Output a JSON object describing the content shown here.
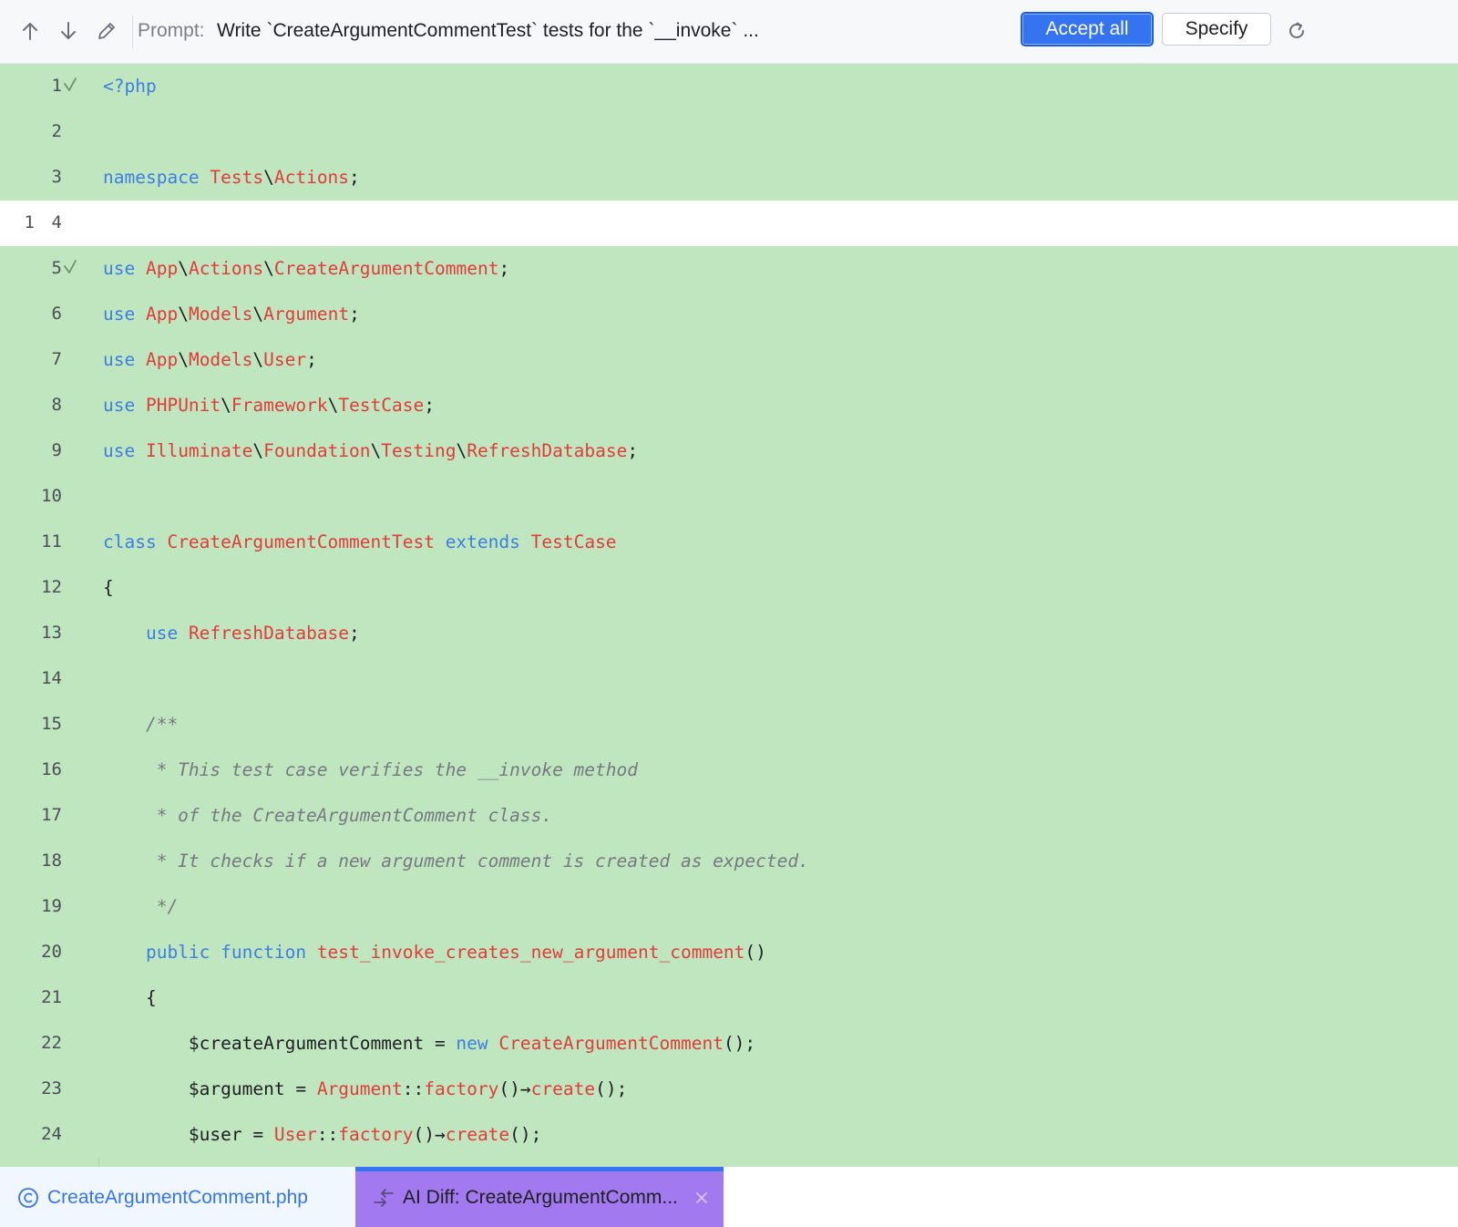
{
  "toolbar": {
    "prompt_label": "Prompt:",
    "prompt_text": "Write `CreateArgumentCommentTest` tests for the `__invoke` ...",
    "accept_all_label": "Accept all",
    "specify_label": "Specify",
    "icons": [
      "arrow-up-icon",
      "arrow-down-icon",
      "pencil-icon",
      "refresh-icon"
    ]
  },
  "colors": {
    "added_bg": "#bfe6bf",
    "keyword": "#3d7fe0",
    "identifier": "#e23b3b",
    "comment": "#767a80",
    "accent": "#3574f0",
    "active_tab": "#a379ef"
  },
  "editor": {
    "lines": [
      {
        "old": "",
        "new": "1",
        "check": true,
        "status": "added",
        "tokens": [
          [
            "kw",
            "<?php"
          ]
        ]
      },
      {
        "old": "",
        "new": "2",
        "check": false,
        "status": "added",
        "tokens": []
      },
      {
        "old": "",
        "new": "3",
        "check": false,
        "status": "added",
        "tokens": [
          [
            "kw",
            "namespace "
          ],
          [
            "id",
            "Tests"
          ],
          [
            "pl",
            "\\"
          ],
          [
            "id",
            "Actions"
          ],
          [
            "pl",
            ";"
          ]
        ]
      },
      {
        "old": "1",
        "new": "4",
        "check": false,
        "status": "unchanged",
        "tokens": []
      },
      {
        "old": "",
        "new": "5",
        "check": true,
        "status": "added",
        "tokens": [
          [
            "kw",
            "use "
          ],
          [
            "id",
            "App"
          ],
          [
            "pl",
            "\\"
          ],
          [
            "id",
            "Actions"
          ],
          [
            "pl",
            "\\"
          ],
          [
            "id",
            "CreateArgumentComment"
          ],
          [
            "pl",
            ";"
          ]
        ]
      },
      {
        "old": "",
        "new": "6",
        "check": false,
        "status": "added",
        "tokens": [
          [
            "kw",
            "use "
          ],
          [
            "id",
            "App"
          ],
          [
            "pl",
            "\\"
          ],
          [
            "id",
            "Models"
          ],
          [
            "pl",
            "\\"
          ],
          [
            "id",
            "Argument"
          ],
          [
            "pl",
            ";"
          ]
        ]
      },
      {
        "old": "",
        "new": "7",
        "check": false,
        "status": "added",
        "tokens": [
          [
            "kw",
            "use "
          ],
          [
            "id",
            "App"
          ],
          [
            "pl",
            "\\"
          ],
          [
            "id",
            "Models"
          ],
          [
            "pl",
            "\\"
          ],
          [
            "id",
            "User"
          ],
          [
            "pl",
            ";"
          ]
        ]
      },
      {
        "old": "",
        "new": "8",
        "check": false,
        "status": "added",
        "tokens": [
          [
            "kw",
            "use "
          ],
          [
            "id",
            "PHPUnit"
          ],
          [
            "pl",
            "\\"
          ],
          [
            "id",
            "Framework"
          ],
          [
            "pl",
            "\\"
          ],
          [
            "id",
            "TestCase"
          ],
          [
            "pl",
            ";"
          ]
        ]
      },
      {
        "old": "",
        "new": "9",
        "check": false,
        "status": "added",
        "tokens": [
          [
            "kw",
            "use "
          ],
          [
            "id",
            "Illuminate"
          ],
          [
            "pl",
            "\\"
          ],
          [
            "id",
            "Foundation"
          ],
          [
            "pl",
            "\\"
          ],
          [
            "id",
            "Testing"
          ],
          [
            "pl",
            "\\"
          ],
          [
            "id",
            "RefreshDatabase"
          ],
          [
            "pl",
            ";"
          ]
        ]
      },
      {
        "old": "",
        "new": "10",
        "check": false,
        "status": "added",
        "tokens": []
      },
      {
        "old": "",
        "new": "11",
        "check": false,
        "status": "added",
        "tokens": [
          [
            "kw",
            "class "
          ],
          [
            "id",
            "CreateArgumentCommentTest"
          ],
          [
            "kw",
            " extends "
          ],
          [
            "id",
            "TestCase"
          ]
        ]
      },
      {
        "old": "",
        "new": "12",
        "check": false,
        "status": "added",
        "tokens": [
          [
            "pl",
            "{"
          ]
        ]
      },
      {
        "old": "",
        "new": "13",
        "check": false,
        "status": "added",
        "tokens": [
          [
            "pl",
            "    "
          ],
          [
            "kw",
            "use "
          ],
          [
            "id",
            "RefreshDatabase"
          ],
          [
            "pl",
            ";"
          ]
        ]
      },
      {
        "old": "",
        "new": "14",
        "check": false,
        "status": "added",
        "tokens": []
      },
      {
        "old": "",
        "new": "15",
        "check": false,
        "status": "added",
        "tokens": [
          [
            "cm",
            "    /**"
          ]
        ]
      },
      {
        "old": "",
        "new": "16",
        "check": false,
        "status": "added",
        "tokens": [
          [
            "cm",
            "     * This test case verifies the __invoke method"
          ]
        ]
      },
      {
        "old": "",
        "new": "17",
        "check": false,
        "status": "added",
        "tokens": [
          [
            "cm",
            "     * of the CreateArgumentComment class."
          ]
        ]
      },
      {
        "old": "",
        "new": "18",
        "check": false,
        "status": "added",
        "tokens": [
          [
            "cm",
            "     * It checks if a new argument comment is created as expected."
          ]
        ]
      },
      {
        "old": "",
        "new": "19",
        "check": false,
        "status": "added",
        "tokens": [
          [
            "cm",
            "     */"
          ]
        ]
      },
      {
        "old": "",
        "new": "20",
        "check": false,
        "status": "added",
        "tokens": [
          [
            "pl",
            "    "
          ],
          [
            "kw",
            "public function "
          ],
          [
            "id",
            "test_invoke_creates_new_argument_comment"
          ],
          [
            "pl",
            "()"
          ]
        ]
      },
      {
        "old": "",
        "new": "21",
        "check": false,
        "status": "added",
        "tokens": [
          [
            "pl",
            "    {"
          ]
        ]
      },
      {
        "old": "",
        "new": "22",
        "check": false,
        "status": "added",
        "tokens": [
          [
            "pl",
            "        $createArgumentComment = "
          ],
          [
            "kw",
            "new "
          ],
          [
            "id",
            "CreateArgumentComment"
          ],
          [
            "pl",
            "();"
          ]
        ]
      },
      {
        "old": "",
        "new": "23",
        "check": false,
        "status": "added",
        "tokens": [
          [
            "pl",
            "        $argument = "
          ],
          [
            "id",
            "Argument"
          ],
          [
            "pl",
            "::"
          ],
          [
            "id",
            "factory"
          ],
          [
            "pl",
            "()→"
          ],
          [
            "id",
            "create"
          ],
          [
            "pl",
            "();"
          ]
        ]
      },
      {
        "old": "",
        "new": "24",
        "check": false,
        "status": "added",
        "tokens": [
          [
            "pl",
            "        $user = "
          ],
          [
            "id",
            "User"
          ],
          [
            "pl",
            "::"
          ],
          [
            "id",
            "factory"
          ],
          [
            "pl",
            "()→"
          ],
          [
            "id",
            "create"
          ],
          [
            "pl",
            "();"
          ]
        ]
      }
    ]
  },
  "tabs": [
    {
      "label": "CreateArgumentComment.php",
      "icon": "class-c-icon",
      "active": false
    },
    {
      "label": "AI Diff: CreateArgumentComm...",
      "icon": "ai-diff-icon",
      "active": true
    }
  ]
}
